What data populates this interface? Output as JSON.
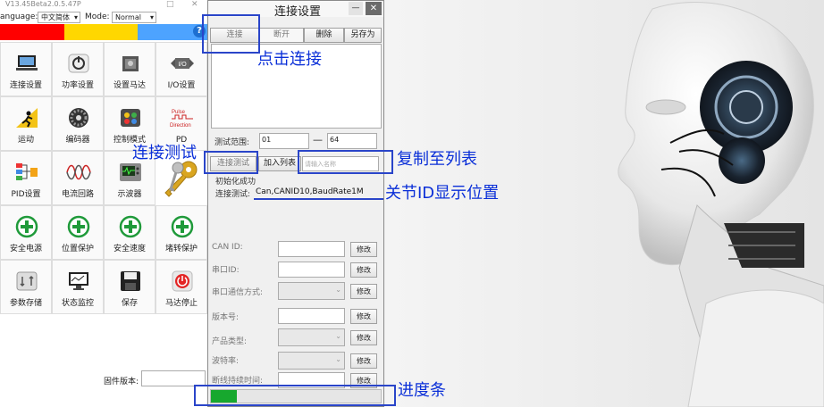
{
  "main_window": {
    "title": "V13.45Beta2.0.5.47P",
    "language_label": "anguage:",
    "language_value": "中文简体",
    "mode_label": "Mode:",
    "mode_value": "Normal",
    "help_icon": "?",
    "color_bar": [
      "#ff0000",
      "#ffd700",
      "#4da3ff"
    ],
    "grid": [
      {
        "label": "连接设置",
        "icon": "laptop-icon"
      },
      {
        "label": "功率设置",
        "icon": "power-icon"
      },
      {
        "label": "设置马达",
        "icon": "motor-icon"
      },
      {
        "label": "I/O设置",
        "icon": "io-icon",
        "icon_text": "I/O"
      },
      {
        "label": "运动",
        "icon": "run-icon"
      },
      {
        "label": "编码器",
        "icon": "encoder-icon"
      },
      {
        "label": "控制模式",
        "icon": "control-icon"
      },
      {
        "label": "PD",
        "icon": "pulse-direction-icon",
        "icon_text_1": "Pulse",
        "icon_text_2": "Direction"
      },
      {
        "label": "PID设置",
        "icon": "pid-icon"
      },
      {
        "label": "电流回路",
        "icon": "wave-icon"
      },
      {
        "label": "示波器",
        "icon": "oscilloscope-icon"
      },
      {
        "label": "",
        "icon": "keys-icon"
      },
      {
        "label": "安全电源",
        "icon": "safety-icon"
      },
      {
        "label": "位置保护",
        "icon": "safety-icon"
      },
      {
        "label": "安全速度",
        "icon": "safety-icon"
      },
      {
        "label": "堵转保护",
        "icon": "safety-icon"
      },
      {
        "label": "参数存储",
        "icon": "storage-icon"
      },
      {
        "label": "状态监控",
        "icon": "monitor-icon"
      },
      {
        "label": "保存",
        "icon": "save-icon"
      },
      {
        "label": "马达停止",
        "icon": "stop-icon"
      }
    ],
    "firmware_label": "固件版本:"
  },
  "dialog": {
    "title": "连接设置",
    "minimize": "—",
    "close": "✕",
    "buttons": {
      "connect": "连接",
      "disconnect": "断开",
      "delete": "删除",
      "save_as": "另存为"
    },
    "test_range_label": "测试范围:",
    "range_from": "01",
    "range_dash": "—",
    "range_to": "64",
    "test_button": "连接测试",
    "add_to_list_button": "加入列表",
    "name_placeholder": "请输入名称",
    "init_status": "初始化成功",
    "conn_test_label": "连接测试:",
    "conn_test_value": "Can,CANID10,BaudRate1M",
    "fields": [
      {
        "label": "CAN ID:",
        "type": "input",
        "button": "修改"
      },
      {
        "label": "串口ID:",
        "type": "input",
        "button": "修改"
      },
      {
        "label": "串口通信方式:",
        "type": "select",
        "button": "修改"
      },
      {
        "label": "版本号:",
        "type": "input",
        "button": "修改"
      },
      {
        "label": "产品类型:",
        "type": "select",
        "button": "修改"
      },
      {
        "label": "波特率:",
        "type": "select",
        "button": "修改"
      },
      {
        "label": "断线持续时间:",
        "type": "input",
        "button": "修改"
      }
    ],
    "progress": 0.15,
    "progress_color": "#17a82e"
  },
  "annotations": {
    "click_connect": "点击连接",
    "connect_test": "连接测试",
    "copy_to_list": "复制至列表",
    "id_position": "关节ID显示位置",
    "progress_bar": "进度条"
  },
  "colors": {
    "annotation": "#0a2fd8",
    "highlight_box": "#2a45c9"
  }
}
